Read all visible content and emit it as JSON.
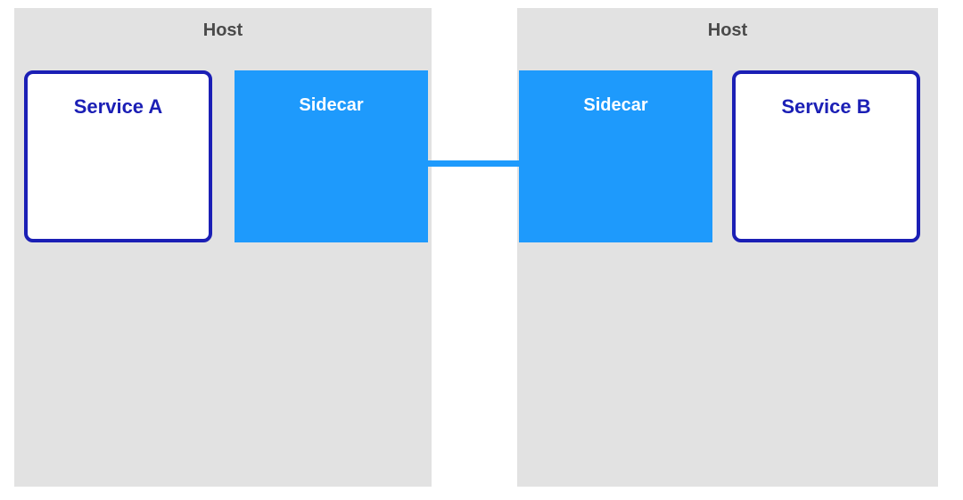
{
  "colors": {
    "host_bg": "#e2e2e2",
    "host_title": "#4a4a4a",
    "service_border": "#1b1fb5",
    "service_text": "#1b1fb5",
    "sidecar_fill": "#1e9afc",
    "sidecar_text": "#ffffff",
    "connector": "#1e9afc"
  },
  "diagram": {
    "link_description": "sidecar-to-sidecar-connector",
    "host_left": {
      "title": "Host",
      "service": {
        "label": "Service A"
      },
      "sidecar": {
        "label": "Sidecar"
      }
    },
    "host_right": {
      "title": "Host",
      "service": {
        "label": "Service B"
      },
      "sidecar": {
        "label": "Sidecar"
      }
    }
  }
}
